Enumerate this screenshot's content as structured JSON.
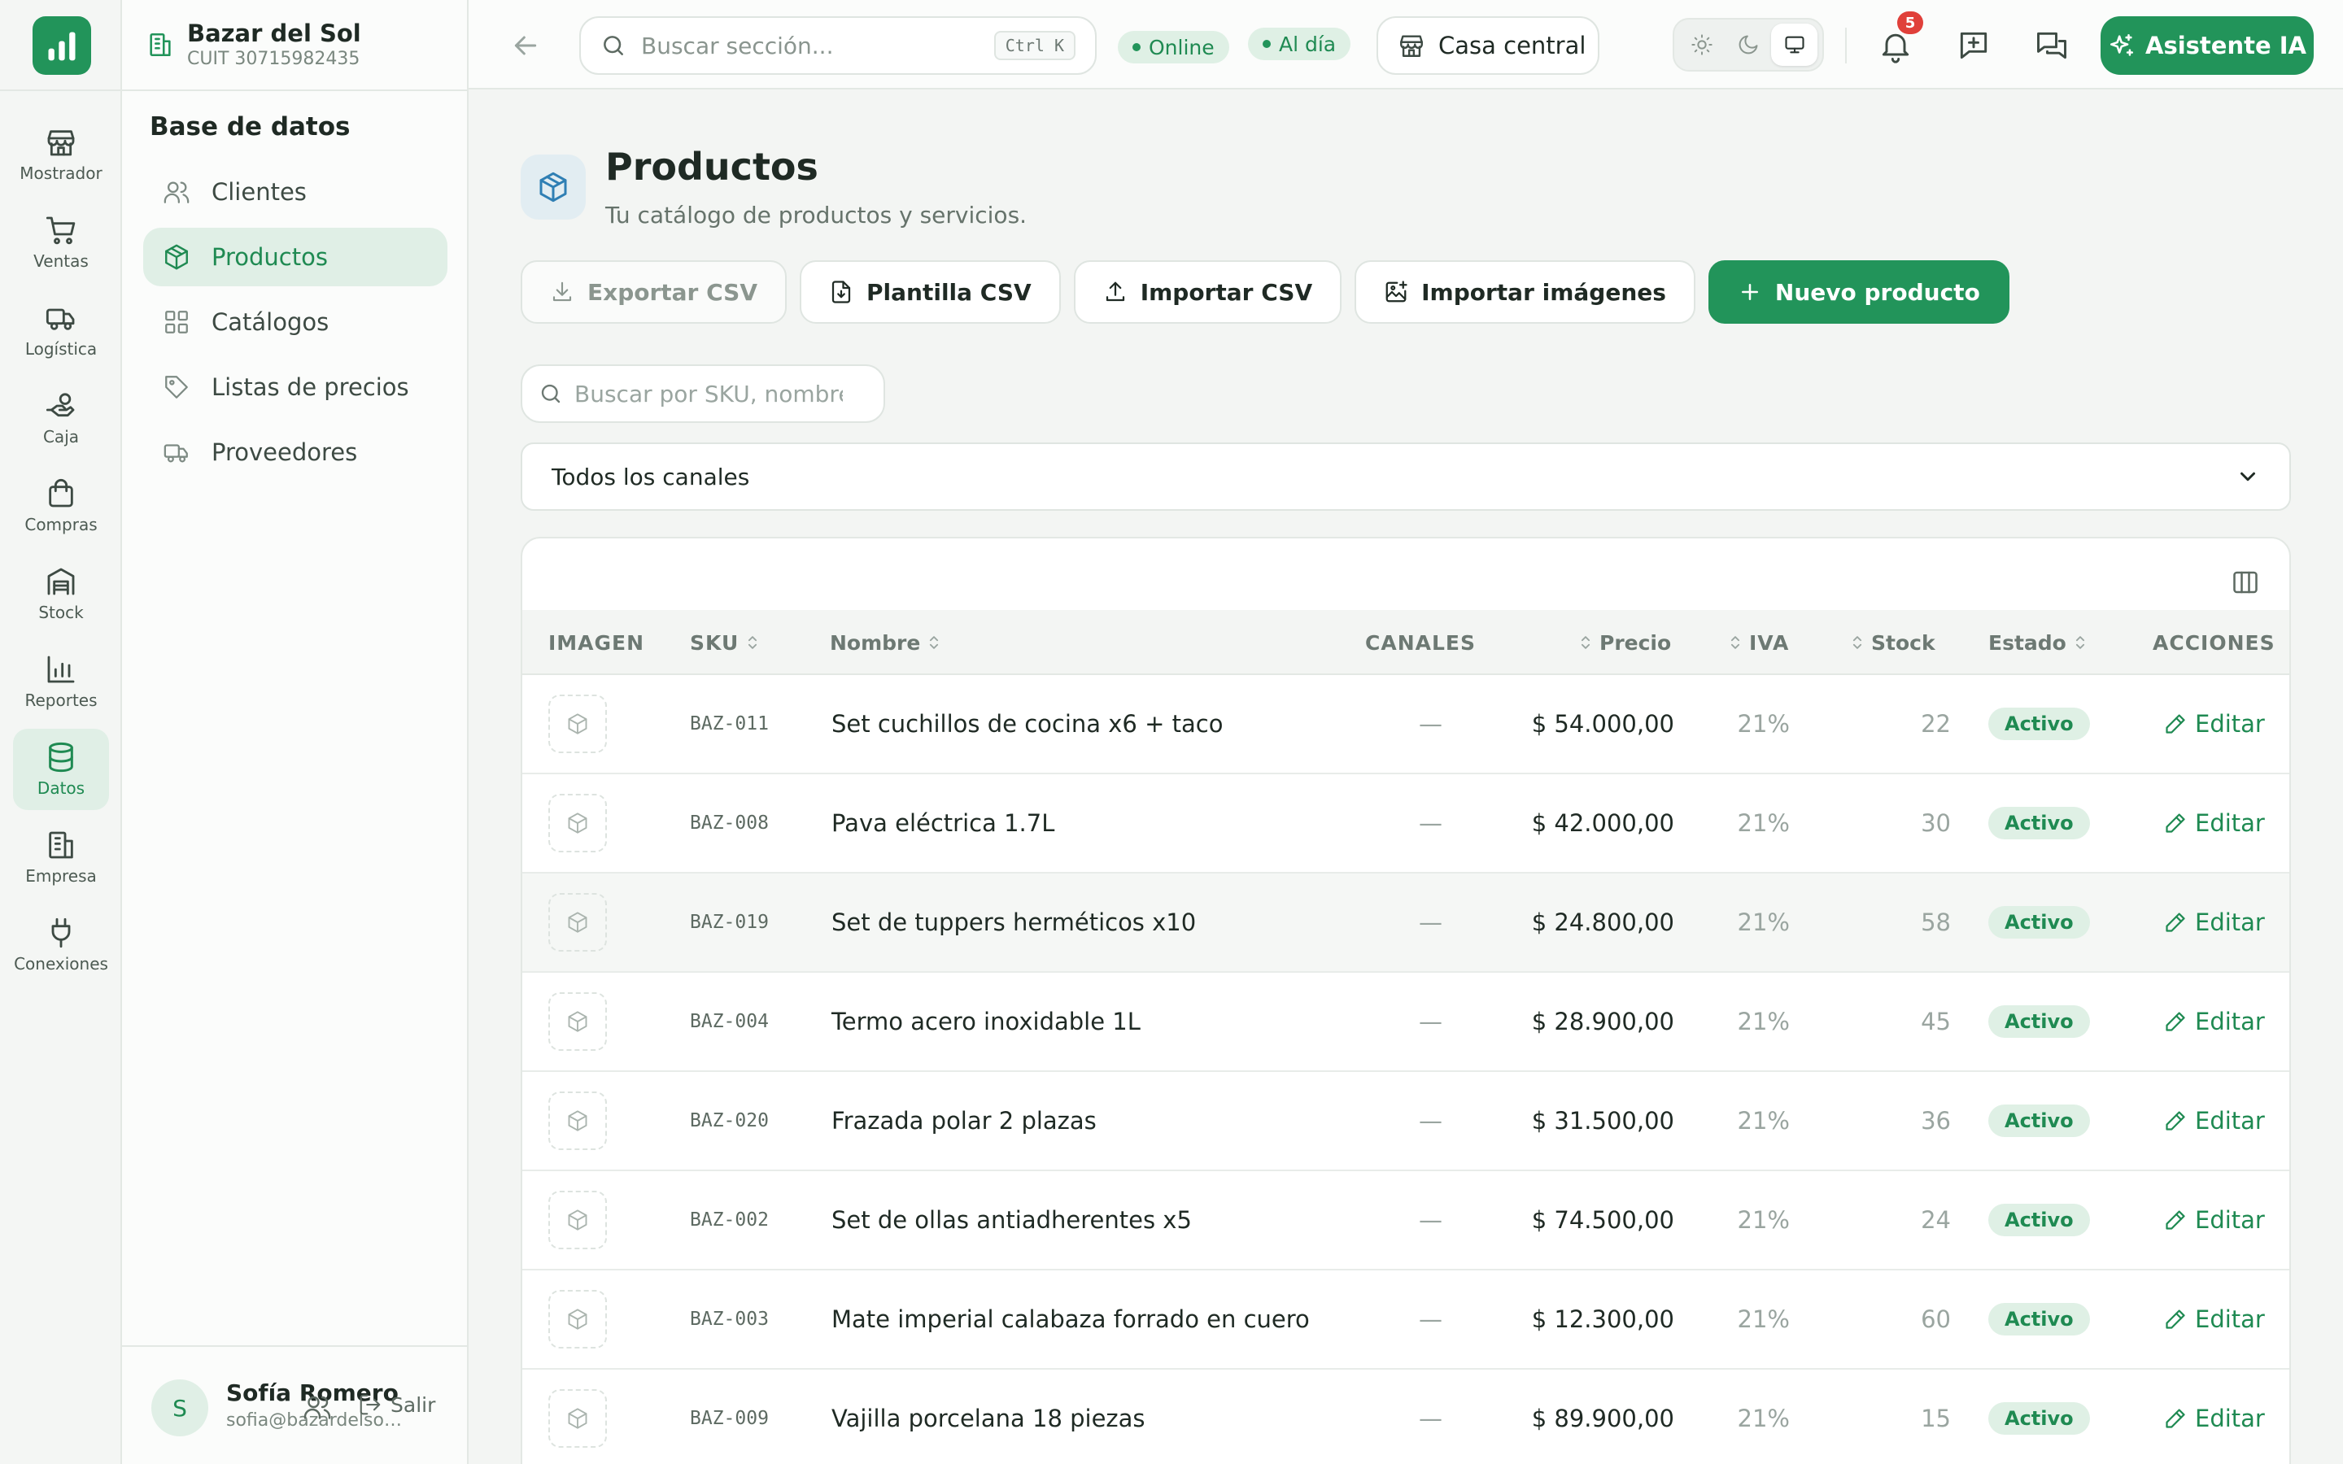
{
  "rail": {
    "items": [
      {
        "label": "Mostrador",
        "icon": "store-icon"
      },
      {
        "label": "Ventas",
        "icon": "cart-icon"
      },
      {
        "label": "Logística",
        "icon": "truck-icon"
      },
      {
        "label": "Caja",
        "icon": "cash-hand-icon"
      },
      {
        "label": "Compras",
        "icon": "shopping-bag-icon"
      },
      {
        "label": "Stock",
        "icon": "warehouse-icon"
      },
      {
        "label": "Reportes",
        "icon": "bar-chart-icon"
      },
      {
        "label": "Datos",
        "icon": "database-icon"
      },
      {
        "label": "Empresa",
        "icon": "building-icon"
      },
      {
        "label": "Conexiones",
        "icon": "plug-icon"
      }
    ],
    "active": "Datos"
  },
  "brand": {
    "name": "Bazar del Sol",
    "cuit": "CUIT 30715982435"
  },
  "sidebar": {
    "title": "Base de datos",
    "items": [
      {
        "label": "Clientes",
        "icon": "users-icon"
      },
      {
        "label": "Productos",
        "icon": "box-icon"
      },
      {
        "label": "Catálogos",
        "icon": "grid-icon"
      },
      {
        "label": "Listas de precios",
        "icon": "tag-icon"
      },
      {
        "label": "Proveedores",
        "icon": "truck-icon"
      }
    ],
    "active": "Productos"
  },
  "user": {
    "initial": "S",
    "name": "Sofía Romero",
    "email": "sofia@bazardelsol.com",
    "logout_label": "Salir"
  },
  "topbar": {
    "search_placeholder": "Buscar sección...",
    "search_shortcut": "Ctrl K",
    "status_online": "Online",
    "status_sync": "Al día",
    "branch": "Casa central",
    "notifications_count": "5",
    "ai_label": "Asistente IA"
  },
  "page": {
    "title": "Productos",
    "subtitle": "Tu catálogo de productos y servicios.",
    "actions": {
      "export": "Exportar CSV",
      "template": "Plantilla CSV",
      "import": "Importar CSV",
      "import_images": "Importar imágenes",
      "new": "Nuevo producto"
    },
    "filter_placeholder": "Buscar por SKU, nombre",
    "channel_filter": "Todos los canales"
  },
  "table": {
    "headers": {
      "image": "IMAGEN",
      "sku": "SKU",
      "name": "Nombre",
      "channels": "CANALES",
      "price": "Precio",
      "iva": "IVA",
      "stock": "Stock",
      "status": "Estado",
      "actions": "ACCIONES"
    },
    "edit_label": "Editar",
    "rows": [
      {
        "sku": "BAZ-011",
        "name": "Set cuchillos de cocina x6 + taco",
        "channels": "—",
        "price": "$ 54.000,00",
        "iva": "21%",
        "stock": "22",
        "status": "Activo"
      },
      {
        "sku": "BAZ-008",
        "name": "Pava eléctrica 1.7L",
        "channels": "—",
        "price": "$ 42.000,00",
        "iva": "21%",
        "stock": "30",
        "status": "Activo"
      },
      {
        "sku": "BAZ-019",
        "name": "Set de tuppers herméticos x10",
        "channels": "—",
        "price": "$ 24.800,00",
        "iva": "21%",
        "stock": "58",
        "status": "Activo"
      },
      {
        "sku": "BAZ-004",
        "name": "Termo acero inoxidable 1L",
        "channels": "—",
        "price": "$ 28.900,00",
        "iva": "21%",
        "stock": "45",
        "status": "Activo"
      },
      {
        "sku": "BAZ-020",
        "name": "Frazada polar 2 plazas",
        "channels": "—",
        "price": "$ 31.500,00",
        "iva": "21%",
        "stock": "36",
        "status": "Activo"
      },
      {
        "sku": "BAZ-002",
        "name": "Set de ollas antiadherentes x5",
        "channels": "—",
        "price": "$ 74.500,00",
        "iva": "21%",
        "stock": "24",
        "status": "Activo"
      },
      {
        "sku": "BAZ-003",
        "name": "Mate imperial calabaza forrado en cuero",
        "channels": "—",
        "price": "$ 12.300,00",
        "iva": "21%",
        "stock": "60",
        "status": "Activo"
      },
      {
        "sku": "BAZ-009",
        "name": "Vajilla porcelana 18 piezas",
        "channels": "—",
        "price": "$ 89.900,00",
        "iva": "21%",
        "stock": "15",
        "status": "Activo"
      }
    ]
  },
  "colors": {
    "accent": "#22945a",
    "accent_soft": "#e0efe6",
    "badge": "#e0403a"
  }
}
